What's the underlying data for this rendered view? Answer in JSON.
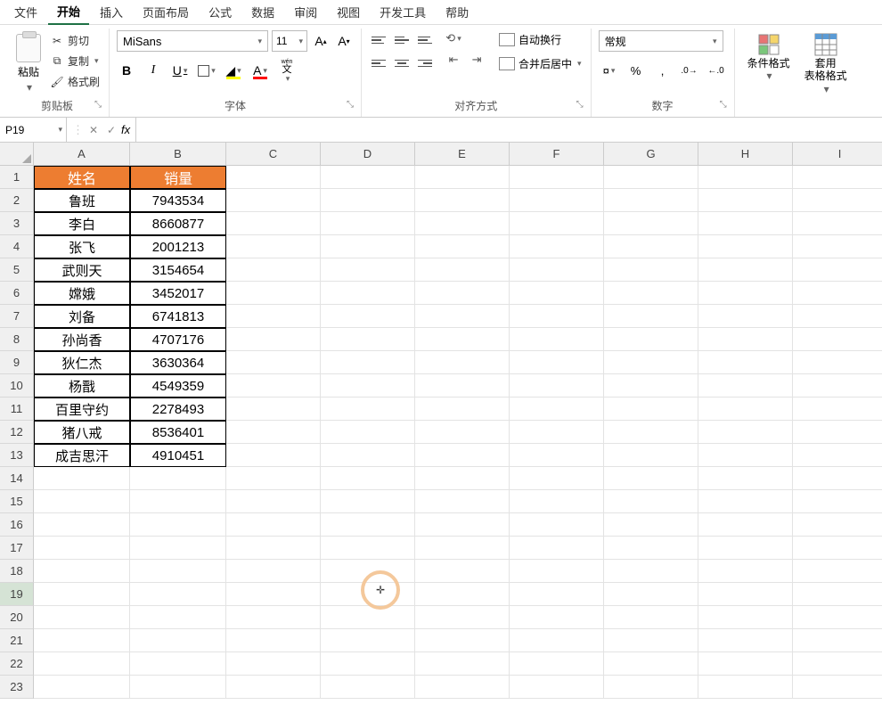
{
  "menubar": {
    "items": [
      "文件",
      "开始",
      "插入",
      "页面布局",
      "公式",
      "数据",
      "审阅",
      "视图",
      "开发工具",
      "帮助"
    ],
    "active_index": 1
  },
  "ribbon": {
    "clipboard": {
      "label": "剪贴板",
      "paste": "粘贴",
      "cut": "剪切",
      "copy": "复制",
      "painter": "格式刷"
    },
    "font": {
      "label": "字体",
      "name": "MiSans",
      "size": "11",
      "pinyin": "wén"
    },
    "alignment": {
      "label": "对齐方式",
      "wrap": "自动换行",
      "merge": "合并后居中"
    },
    "number": {
      "label": "数字",
      "format": "常规"
    },
    "styles": {
      "cond_fmt": "条件格式",
      "table_fmt": "套用\n表格格式"
    }
  },
  "namebox": "P19",
  "columns": [
    "A",
    "B",
    "C",
    "D",
    "E",
    "F",
    "G",
    "H",
    "I"
  ],
  "rows": [
    "1",
    "2",
    "3",
    "4",
    "5",
    "6",
    "7",
    "8",
    "9",
    "10",
    "11",
    "12",
    "13",
    "14",
    "15",
    "16",
    "17",
    "18",
    "19",
    "20",
    "21",
    "22",
    "23"
  ],
  "selected_row_index": 18,
  "table": {
    "headers": [
      "姓名",
      "销量"
    ],
    "data": [
      [
        "鲁班",
        "7943534"
      ],
      [
        "李白",
        "8660877"
      ],
      [
        "张飞",
        "2001213"
      ],
      [
        "武则天",
        "3154654"
      ],
      [
        "嫦娥",
        "3452017"
      ],
      [
        "刘备",
        "6741813"
      ],
      [
        "孙尚香",
        "4707176"
      ],
      [
        "狄仁杰",
        "3630364"
      ],
      [
        "杨戬",
        "4549359"
      ],
      [
        "百里守约",
        "2278493"
      ],
      [
        "猪八戒",
        "8536401"
      ],
      [
        "成吉思汗",
        "4910451"
      ]
    ]
  }
}
